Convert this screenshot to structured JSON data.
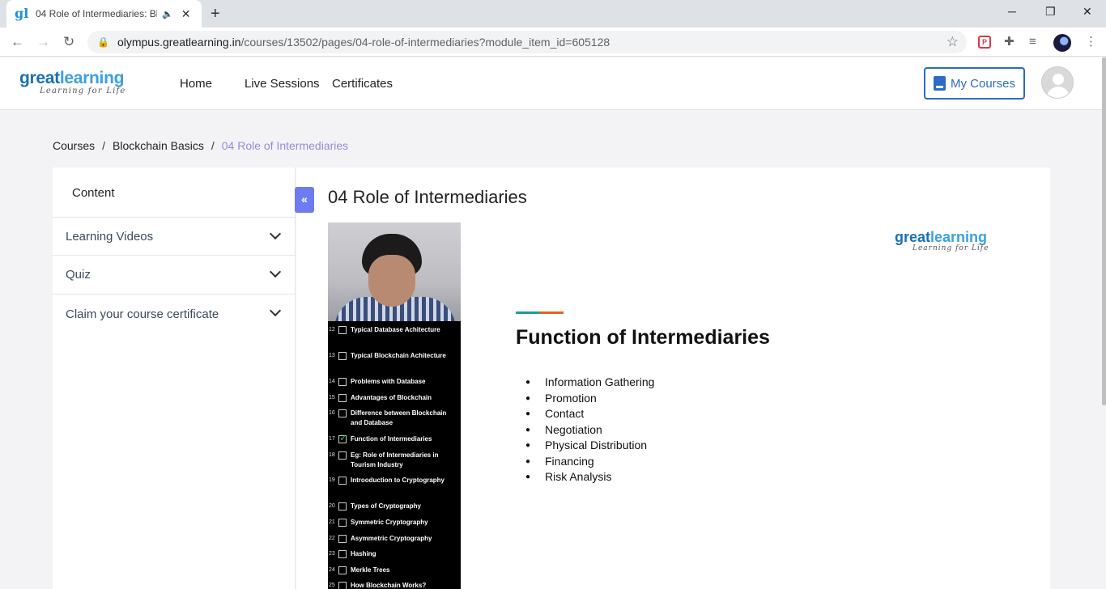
{
  "browser": {
    "tab_title": "04 Role of Intermediaries: Bl",
    "tab_favicon": "gl",
    "url_host": "olympus.greatlearning.in",
    "url_path": "/courses/13502/pages/04-role-of-intermediaries?module_item_id=605128",
    "pocket_ext_label": "P"
  },
  "header": {
    "logo_word_a": "great",
    "logo_word_b": "learning",
    "logo_tagline": "Learning for Life",
    "nav": [
      "Home",
      "Live Sessions",
      "Certificates"
    ],
    "my_courses_label": "My Courses"
  },
  "breadcrumb": {
    "items": [
      "Courses",
      "Blockchain Basics",
      "04 Role of Intermediaries"
    ],
    "separator": "/"
  },
  "sidebar": {
    "title": "Content",
    "sections": [
      "Learning Videos",
      "Quiz",
      "Claim your course certificate"
    ],
    "collapse_glyph": "«"
  },
  "lesson": {
    "title": "04 Role of Intermediaries"
  },
  "video": {
    "playlist": [
      {
        "num": "12",
        "text": "Typical Database Achitecture",
        "done": false
      },
      {
        "num": "13",
        "text": "Typical Blockchain Achitecture",
        "done": false
      },
      {
        "num": "14",
        "text": "Problems with Database",
        "done": false
      },
      {
        "num": "15",
        "text": "Advantages of Blockchain",
        "done": false
      },
      {
        "num": "16",
        "text": "Difference between Blockchain and Database",
        "done": false
      },
      {
        "num": "17",
        "text": "Function of Intermediaries",
        "done": true
      },
      {
        "num": "18",
        "text": "Eg: Role of Intermediaries in Tourism Industry",
        "done": false
      },
      {
        "num": "19",
        "text": "Introoduction to Cryptography",
        "done": false
      },
      {
        "num": "20",
        "text": "Types of Cryptography",
        "done": false
      },
      {
        "num": "21",
        "text": "Symmetric Cryptography",
        "done": false
      },
      {
        "num": "22",
        "text": "Asymmetric Cryptography",
        "done": false
      },
      {
        "num": "23",
        "text": "Hashing",
        "done": false
      },
      {
        "num": "24",
        "text": "Merkle Trees",
        "done": false
      },
      {
        "num": "25",
        "text": "How Blockchain Works?",
        "done": false
      }
    ],
    "slide_logo_a": "great",
    "slide_logo_b": "learning",
    "slide_logo_tagline": "Learning for Life",
    "slide_heading": "Function of Intermediaries",
    "bullets": [
      "Information Gathering",
      "Promotion",
      "Contact",
      "Negotiation",
      "Physical Distribution",
      "Financing",
      "Risk Analysis"
    ]
  },
  "colors": {
    "brand_blue": "#1a6fb5",
    "accent_blue": "#2b6cc4",
    "breadcrumb_active": "#9a88d8",
    "collapse_button": "#6d7cf0"
  }
}
